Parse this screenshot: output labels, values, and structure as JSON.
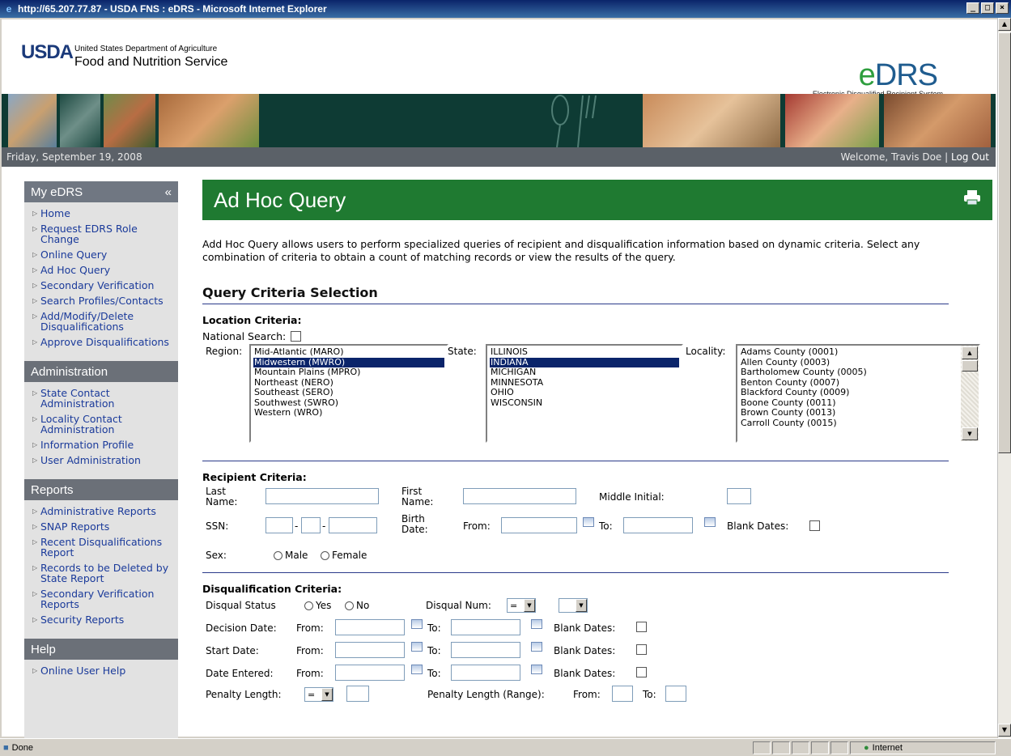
{
  "window": {
    "title": "http://65.207.77.87 - USDA FNS : eDRS - Microsoft Internet Explorer",
    "status_text": "Done",
    "zone_text": "Internet"
  },
  "header": {
    "usda_logo": "USDA",
    "agency_line1": "United States Department of Agriculture",
    "agency_line2": "Food and Nutrition Service",
    "edrs_e": "e",
    "edrs_rest": "DRS",
    "edrs_subtitle": "Electronic Disqualified Recipient System"
  },
  "dateline": {
    "date": "Friday, September 19, 2008",
    "welcome": "Welcome, Travis Doe",
    "separator": " | ",
    "logout": "Log Out"
  },
  "sidebar": {
    "collapse_glyph": "«",
    "my_edrs": {
      "title": "My eDRS",
      "items": [
        "Home",
        "Request EDRS Role Change",
        "Online Query",
        "Ad Hoc Query",
        "Secondary Verification",
        "Search Profiles/Contacts",
        "Add/Modify/Delete Disqualifications",
        "Approve Disqualifications"
      ]
    },
    "administration": {
      "title": "Administration",
      "items": [
        "State Contact Administration",
        "Locality Contact Administration",
        "Information Profile",
        "User Administration"
      ]
    },
    "reports": {
      "title": "Reports",
      "items": [
        "Administrative Reports",
        "SNAP Reports",
        "Recent Disqualifications Report",
        "Records to be Deleted by State Report",
        "Secondary Verification Reports",
        "Security Reports"
      ]
    },
    "help": {
      "title": "Help",
      "items": [
        "Online User Help"
      ]
    }
  },
  "main": {
    "title": "Ad Hoc Query",
    "intro": "Add Hoc Query allows users to perform specialized queries of recipient and disqualification information based on dynamic criteria. Select any combination of criteria to obtain a count of matching records or view the results of the query.",
    "section_title": "Query Criteria Selection",
    "location": {
      "heading": "Location Criteria:",
      "national_search": "National Search:",
      "region_label": "Region:",
      "regions": [
        "Mid-Atlantic (MARO)",
        "Midwestern (MWRO)",
        "Mountain Plains (MPRO)",
        "Northeast (NERO)",
        "Southeast (SERO)",
        "Southwest (SWRO)",
        "Western (WRO)"
      ],
      "region_selected": "Midwestern (MWRO)",
      "state_label": "State:",
      "states": [
        "ILLINOIS",
        "INDIANA",
        "MICHIGAN",
        "MINNESOTA",
        "OHIO",
        "WISCONSIN"
      ],
      "state_selected": "INDIANA",
      "locality_label": "Locality:",
      "localities": [
        "Adams County (0001)",
        "Allen County (0003)",
        "Bartholomew County (0005)",
        "Benton County (0007)",
        "Blackford County (0009)",
        "Boone County (0011)",
        "Brown County (0013)",
        "Carroll County (0015)"
      ]
    },
    "recipient": {
      "heading": "Recipient Criteria:",
      "last_name": "Last Name:",
      "first_name": "First Name:",
      "middle_initial": "Middle Initial:",
      "ssn": "SSN:",
      "dash": "-",
      "birth_date": "Birth Date:",
      "from": "From:",
      "to": "To:",
      "blank_dates": "Blank Dates:",
      "sex": "Sex:",
      "male": "Male",
      "female": "Female"
    },
    "disqual": {
      "heading": "Disqualification Criteria:",
      "status": "Disqual Status",
      "yes": "Yes",
      "no": "No",
      "num": "Disqual Num:",
      "num_operator": "=",
      "decision_date": "Decision Date:",
      "start_date": "Start Date:",
      "date_entered": "Date Entered:",
      "from": "From:",
      "to": "To:",
      "blank_dates": "Blank Dates:",
      "penalty_length": "Penalty Length:",
      "penalty_operator": "=",
      "penalty_range": "Penalty Length (Range):",
      "range_from": "From:",
      "range_to": "To:"
    }
  }
}
